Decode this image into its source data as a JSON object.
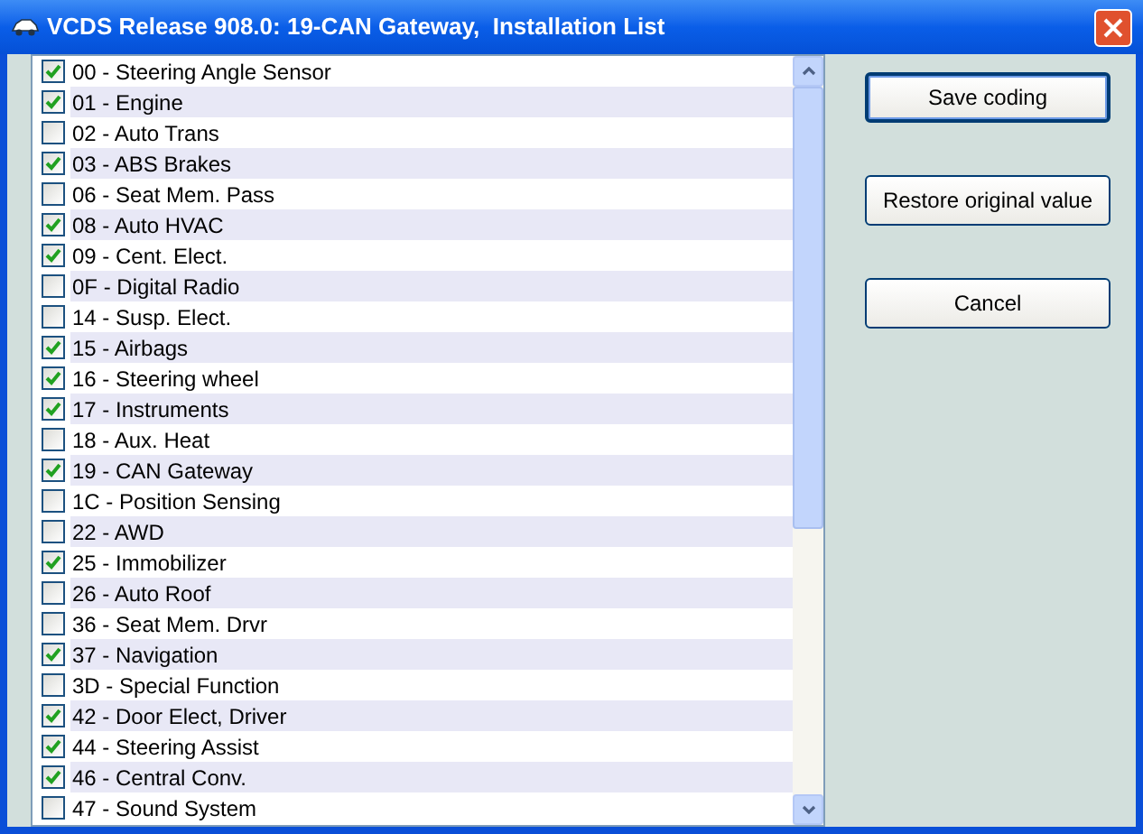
{
  "window": {
    "title": "VCDS Release 908.0: 19-CAN Gateway,  Installation List"
  },
  "modules": [
    {
      "label": "00 - Steering Angle Sensor",
      "checked": true
    },
    {
      "label": "01 - Engine",
      "checked": true
    },
    {
      "label": "02 - Auto Trans",
      "checked": false
    },
    {
      "label": "03 - ABS Brakes",
      "checked": true
    },
    {
      "label": "06 - Seat Mem. Pass",
      "checked": false
    },
    {
      "label": "08 - Auto HVAC",
      "checked": true
    },
    {
      "label": "09 - Cent. Elect.",
      "checked": true
    },
    {
      "label": "0F - Digital Radio",
      "checked": false
    },
    {
      "label": "14 - Susp. Elect.",
      "checked": false
    },
    {
      "label": "15 - Airbags",
      "checked": true
    },
    {
      "label": "16 - Steering wheel",
      "checked": true
    },
    {
      "label": "17 - Instruments",
      "checked": true
    },
    {
      "label": "18 - Aux. Heat",
      "checked": false
    },
    {
      "label": "19 - CAN Gateway",
      "checked": true
    },
    {
      "label": "1C - Position Sensing",
      "checked": false
    },
    {
      "label": "22 - AWD",
      "checked": false
    },
    {
      "label": "25 - Immobilizer",
      "checked": true
    },
    {
      "label": "26 - Auto Roof",
      "checked": false
    },
    {
      "label": "36 - Seat Mem. Drvr",
      "checked": false
    },
    {
      "label": "37 - Navigation",
      "checked": true
    },
    {
      "label": "3D - Special Function",
      "checked": false
    },
    {
      "label": "42 - Door Elect, Driver",
      "checked": true
    },
    {
      "label": "44 - Steering Assist",
      "checked": true
    },
    {
      "label": "46 - Central Conv.",
      "checked": true
    },
    {
      "label": "47 - Sound System",
      "checked": false
    }
  ],
  "buttons": [
    {
      "label": "Save coding",
      "default": true
    },
    {
      "label": "Restore original value",
      "default": false
    },
    {
      "label": "Cancel",
      "default": false
    }
  ]
}
